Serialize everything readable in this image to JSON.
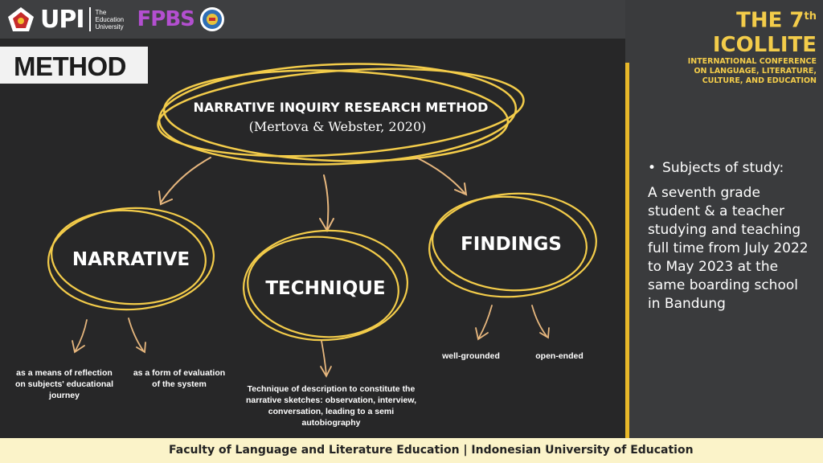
{
  "header": {
    "upi_logo": "UPI",
    "upi_subtitle": "The Education University",
    "fpbs_logo": "FPBS",
    "conference_title_main": "THE 7",
    "conference_title_sup": "th",
    "conference_title_name": "ICOLLITE",
    "conference_subtitle": [
      "INTERNATIONAL CONFERENCE",
      "ON LANGUAGE, LITERATURE,",
      "CULTURE, AND EDUCATION"
    ]
  },
  "slide": {
    "section_label": "METHOD",
    "main_node": {
      "title": "NARRATIVE INQUIRY RESEARCH METHOD",
      "citation": "(Mertova & Webster, 2020)"
    },
    "nodes": [
      {
        "label": "NARRATIVE",
        "children": [
          {
            "lines": [
              "as a means of reflection",
              "on subjects' educational",
              "journey"
            ]
          },
          {
            "lines": [
              "as a form of evaluation",
              "of the system"
            ]
          }
        ]
      },
      {
        "label": "TECHNIQUE",
        "children": [
          {
            "lines": [
              "Technique of description to constitute the",
              "narrative sketches: observation, interview,",
              "conversation, leading to a semi",
              "autobiography"
            ]
          }
        ]
      },
      {
        "label": "FINDINGS",
        "children": [
          {
            "lines": [
              "well-grounded"
            ]
          },
          {
            "lines": [
              "open-ended"
            ]
          }
        ]
      }
    ]
  },
  "side_panel": {
    "bullet_heading": "Subjects of study:",
    "body": "A seventh grade student & a teacher studying and teaching full time from July 2022 to May 2023 at the same boarding school in Bandung"
  },
  "footer": {
    "text": "Faculty of Language and Literature Education | Indonesian University of Education"
  },
  "colors": {
    "accent": "#f3cc4a",
    "slide_bg": "#272728",
    "footer_bg": "#fbf3c9",
    "arrow": "#e7b77e"
  }
}
